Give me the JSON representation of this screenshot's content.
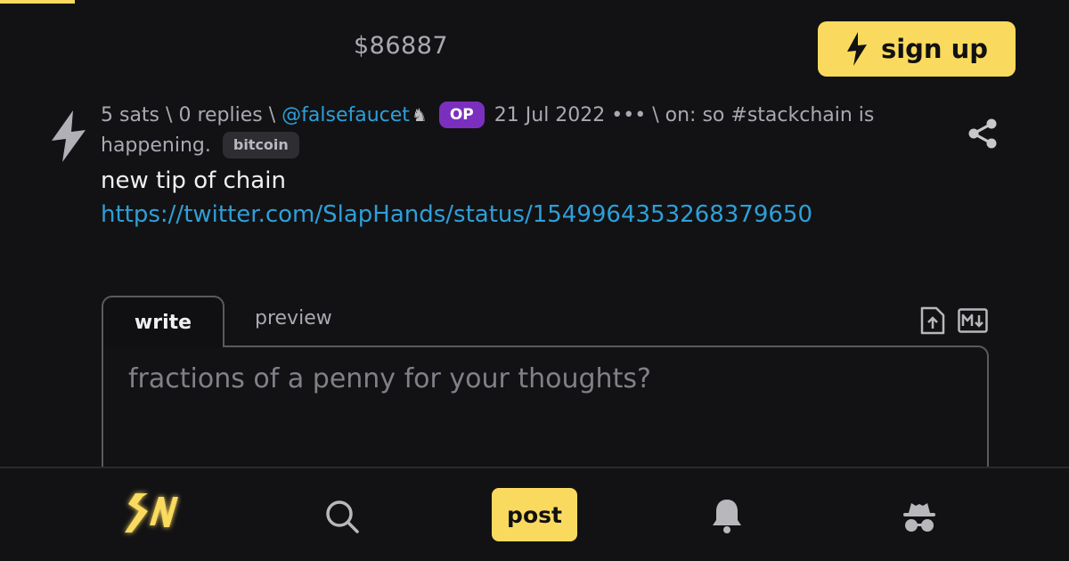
{
  "header": {
    "price": "$86887",
    "signup_label": "sign up"
  },
  "item": {
    "sats": "5 sats",
    "separator": "\\",
    "replies": "0 replies",
    "user": "@falsefaucet",
    "op_badge": "OP",
    "date": "21 Jul 2022",
    "more": "•••",
    "on_label": "on: so #stackchain is happening.",
    "tag": "bitcoin",
    "text": "new tip of chain",
    "link": "https://twitter.com/SlapHands/status/1549964353268379650"
  },
  "reply": {
    "tab_write": "write",
    "tab_preview": "preview",
    "placeholder": "fractions of a penny for your thoughts?"
  },
  "nav": {
    "post_label": "post"
  },
  "colors": {
    "accent": "#fada5e",
    "link": "#2e9fd8",
    "op_badge": "#7b2fbf",
    "background": "#121214"
  },
  "icons": {
    "signup": "lightning-bolt-icon",
    "upvote": "lightning-upvote-icon",
    "horse": "horse-icon",
    "share": "share-icon",
    "upload": "upload-icon",
    "markdown": "markdown-icon",
    "logo": "sn-logo",
    "search": "search-icon",
    "notifications": "bell-icon",
    "profile": "incognito-icon"
  }
}
